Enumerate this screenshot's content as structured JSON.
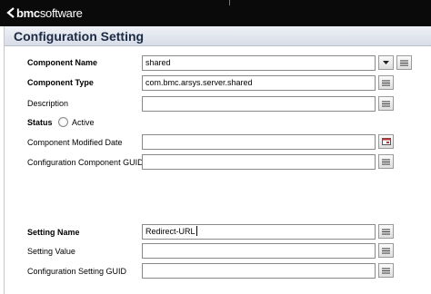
{
  "brand": {
    "logo_text_prefix": "bmc",
    "logo_text_suffix": "software"
  },
  "page": {
    "title": "Configuration Setting"
  },
  "fields": {
    "component_name": {
      "label": "Component Name",
      "value": "shared"
    },
    "component_type": {
      "label": "Component Type",
      "value": "com.bmc.arsys.server.shared"
    },
    "description": {
      "label": "Description",
      "value": ""
    },
    "status": {
      "label": "Status",
      "option": "Active"
    },
    "component_modified_date": {
      "label": "Component Modified Date",
      "value": ""
    },
    "configuration_component_guid": {
      "label": "Configuration Component GUID",
      "value": ""
    },
    "setting_name": {
      "label": "Setting Name",
      "value": "Redirect-URL"
    },
    "setting_value": {
      "label": "Setting Value",
      "value": ""
    },
    "configuration_setting_guid": {
      "label": "Configuration Setting GUID",
      "value": ""
    }
  },
  "icons": {
    "dropdown": "chevron-down-icon",
    "expand": "expand-text-icon",
    "calendar": "calendar-icon"
  }
}
